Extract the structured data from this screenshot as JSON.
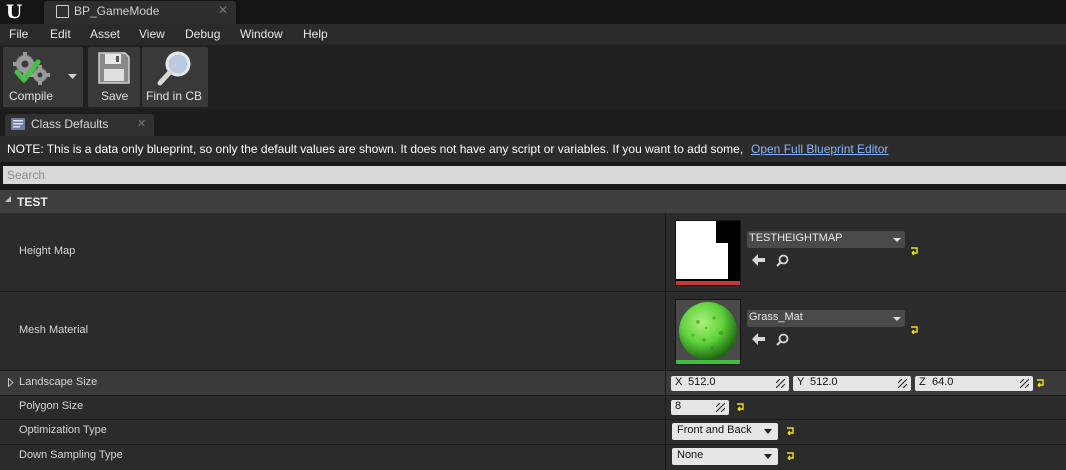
{
  "window": {
    "tab_title": "BP_GameMode"
  },
  "menu": [
    "File",
    "Edit",
    "Asset",
    "View",
    "Debug",
    "Window",
    "Help"
  ],
  "toolbar": {
    "compile_label": "Compile",
    "save_label": "Save",
    "find_label": "Find in CB"
  },
  "panel": {
    "tab_label": "Class Defaults"
  },
  "notice": {
    "text": "NOTE: This is a data only blueprint, so only the default values are shown.  It does not have any script or variables.  If you want to add some,",
    "link": "Open Full Blueprint Editor"
  },
  "search": {
    "placeholder": "Search"
  },
  "category": {
    "label": "TEST"
  },
  "properties": {
    "height_map": {
      "label": "Height Map",
      "asset": "TESTHEIGHTMAP"
    },
    "mesh_material": {
      "label": "Mesh Material",
      "asset": "Grass_Mat"
    },
    "landscape_size": {
      "label": "Landscape Size",
      "x_label": "X",
      "x": "512.0",
      "y_label": "Y",
      "y": "512.0",
      "z_label": "Z",
      "z": "64.0"
    },
    "polygon_size": {
      "label": "Polygon Size",
      "value": "8"
    },
    "optimization_type": {
      "label": "Optimization Type",
      "value": "Front and Back"
    },
    "down_sampling_type": {
      "label": "Down Sampling Type",
      "value": "None"
    }
  },
  "colors": {
    "link": "#86b5ff",
    "reset_arrow": "#f2e600",
    "texture_underline": "#c23a3a",
    "material_underline": "#3fbf3f",
    "grass": "#5fd23c"
  },
  "icons": {
    "compile": "gear-check-icon",
    "save": "floppy-disk-icon",
    "find": "magnifier-icon",
    "browse_back": "arrow-left-icon",
    "browse_find": "search-icon",
    "reset": "reset-to-default-icon"
  }
}
